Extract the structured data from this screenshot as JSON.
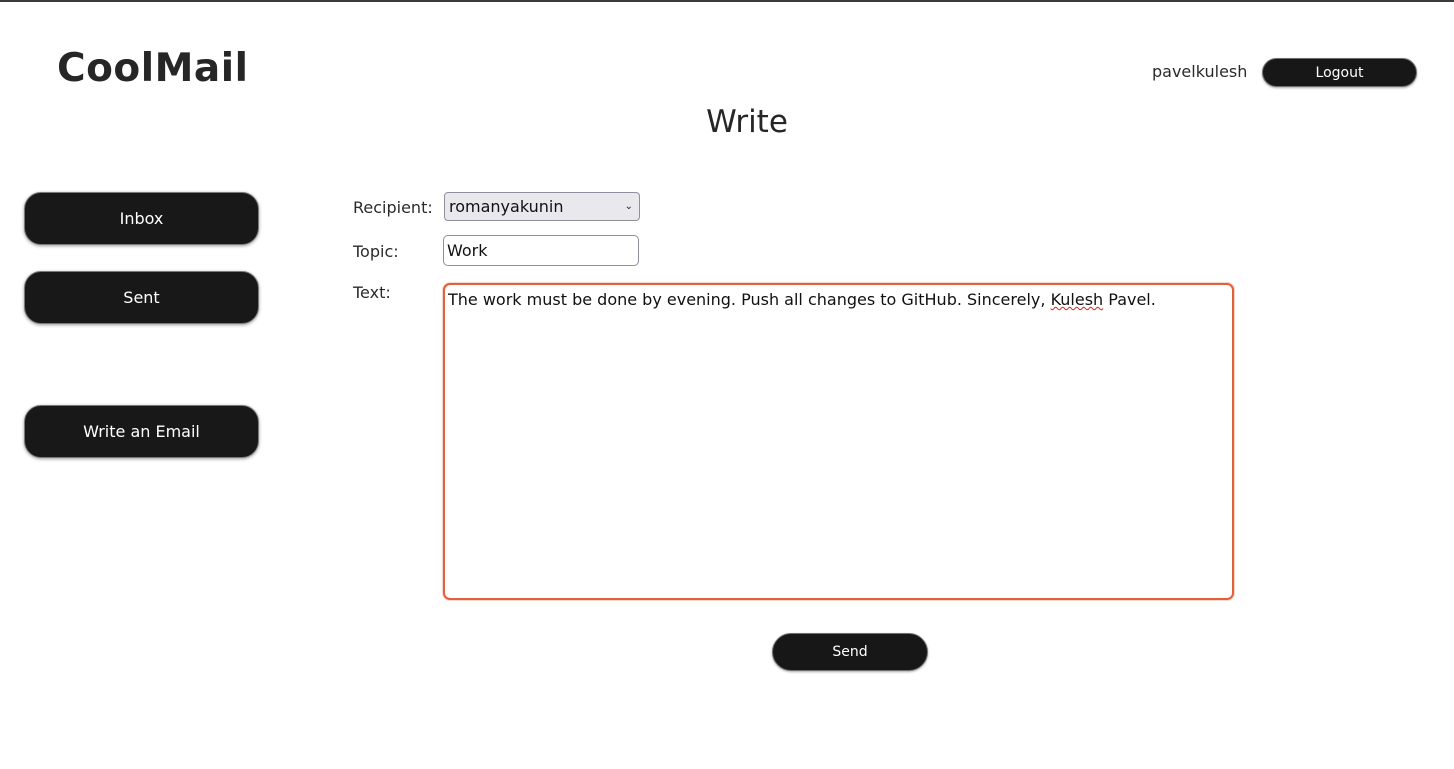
{
  "app": {
    "title": "CoolMail"
  },
  "header": {
    "username": "pavelkulesh",
    "logout_label": "Logout"
  },
  "page": {
    "title": "Write"
  },
  "sidebar": {
    "items": [
      {
        "label": "Inbox"
      },
      {
        "label": "Sent"
      },
      {
        "label": "Write an Email"
      }
    ]
  },
  "form": {
    "recipient": {
      "label": "Recipient:",
      "selected": "romanyakunin"
    },
    "topic": {
      "label": "Topic:",
      "value": "Work"
    },
    "text": {
      "label": "Text:",
      "value_before": "The work must be done by evening. Push all changes to GitHub. Sincerely, ",
      "value_misspelled": "Kulesh",
      "value_after": " Pavel."
    },
    "send_label": "Send"
  },
  "colors": {
    "button_bg": "#171717",
    "focus_border": "#e0623a"
  }
}
